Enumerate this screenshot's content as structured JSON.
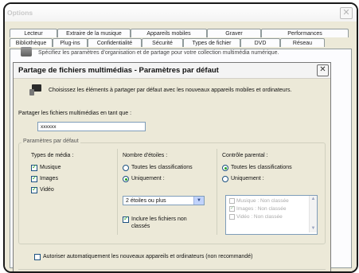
{
  "options": {
    "title": "Options",
    "tabs_row1": [
      "Lecteur",
      "Extraire de la musique",
      "Appareils mobiles",
      "Graver",
      "Performances"
    ],
    "tabs_row2": [
      "Bibliothèque",
      "Plug-ins",
      "Confidentialité",
      "Sécurité",
      "Types de fichier",
      "DVD",
      "Réseau"
    ],
    "description": "Spécifiez les paramètres d'organisation et de partage pour votre collection multimédia numérique."
  },
  "dialog": {
    "title": "Partage de fichiers multimédias - Paramètres par défaut",
    "intro": "Choisissez les éléments à partager par défaut avec les nouveaux appareils mobiles et ordinateurs.",
    "share_as_label": "Partager les fichiers multimédias en tant que :",
    "share_as_value": "xxxxxx",
    "defaults_legend": "Paramètres par défaut",
    "media_types": {
      "title": "Types de média :",
      "items": [
        {
          "label": "Musique",
          "checked": true
        },
        {
          "label": "Images",
          "checked": true
        },
        {
          "label": "Vidéo",
          "checked": true
        }
      ]
    },
    "stars": {
      "title": "Nombre d'étoiles :",
      "options": [
        {
          "label": "Toutes les classifications",
          "selected": false
        },
        {
          "label": "Uniquement :",
          "selected": true
        }
      ],
      "dropdown_value": "2 étoiles ou plus",
      "include_unrated": {
        "label_line1": "Inclure les fichiers non",
        "label_line2": "classés",
        "checked": true
      }
    },
    "parental": {
      "title": "Contrôle parental :",
      "options": [
        {
          "label": "Toutes les classifications",
          "selected": true
        },
        {
          "label": "Uniquement :",
          "selected": false
        }
      ],
      "list": [
        {
          "label": "Musique : Non classée",
          "checked": false
        },
        {
          "label": "Images : Non classée",
          "checked": true
        },
        {
          "label": "Vidéo : Non classée",
          "checked": false
        }
      ]
    },
    "auto_allow": {
      "label": "Autoriser automatiquement les nouveaux appareils et ordinateurs (non recommandé)",
      "checked": false
    }
  },
  "colors": {
    "accent_check": "#21a121",
    "dialog_bg": "#ece9d8",
    "input_border": "#7f9db9"
  }
}
